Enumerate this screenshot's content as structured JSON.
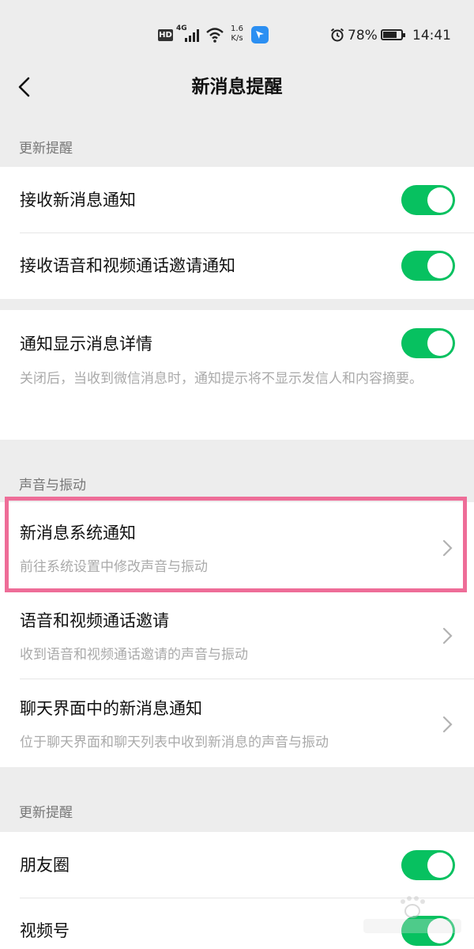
{
  "status_bar": {
    "hd": "HD",
    "network": "4G",
    "speed_value": "1.6",
    "speed_unit": "K/s",
    "battery": "78%",
    "battery_level": 0.78,
    "time": "14:41"
  },
  "nav": {
    "title": "新消息提醒"
  },
  "sections": {
    "update_reminder": {
      "header": "更新提醒",
      "receive_new_message": {
        "label": "接收新消息通知",
        "enabled": true
      },
      "receive_call_invite": {
        "label": "接收语音和视频通话邀请通知",
        "enabled": true
      }
    },
    "details": {
      "show_details": {
        "label": "通知显示消息详情",
        "enabled": true
      },
      "description": "关闭后，当收到微信消息时，通知提示将不显示发信人和内容摘要。"
    },
    "sound_vibration": {
      "header": "声音与振动",
      "system_notify": {
        "label": "新消息系统通知",
        "sub": "前往系统设置中修改声音与振动"
      },
      "call_invite": {
        "label": "语音和视频通话邀请",
        "sub": "收到语音和视频通话邀请的声音与振动"
      },
      "chat_notify": {
        "label": "聊天界面中的新消息通知",
        "sub": "位于聊天界面和聊天列表中收到新消息的声音与振动"
      }
    },
    "update_reminder_2": {
      "header": "更新提醒",
      "moments": {
        "label": "朋友圈",
        "enabled": true
      },
      "channels": {
        "label": "视频号",
        "enabled": true
      }
    }
  },
  "colors": {
    "toggle_on": "#07c160",
    "highlight": "#ee6d98",
    "background": "#ededed"
  }
}
